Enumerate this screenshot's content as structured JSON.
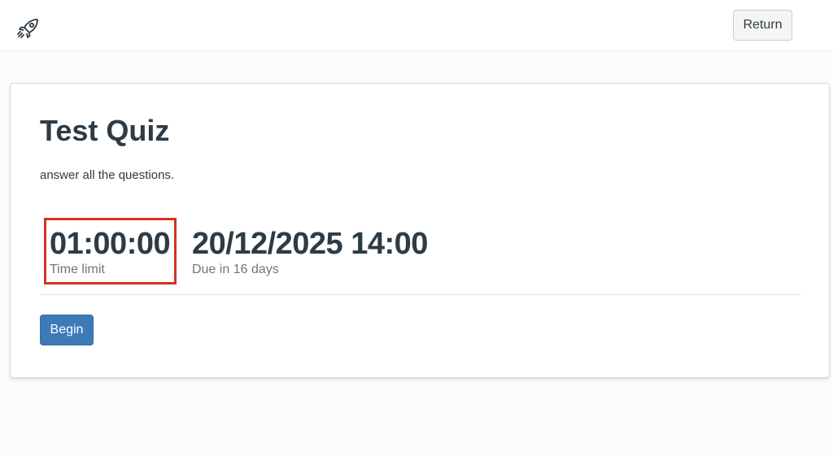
{
  "header": {
    "logo_icon": "rocket-icon",
    "return_label": "Return"
  },
  "quiz": {
    "title": "Test Quiz",
    "description": "answer all the questions.",
    "time_limit": {
      "value": "01:00:00",
      "label": "Time limit"
    },
    "due": {
      "value": "20/12/2025 14:00",
      "label": "Due in 16 days"
    },
    "begin_label": "Begin"
  },
  "colors": {
    "primary": "#3e7ab8",
    "text": "#2d3b45",
    "muted": "#6b7780",
    "highlight": "#d2331f"
  }
}
